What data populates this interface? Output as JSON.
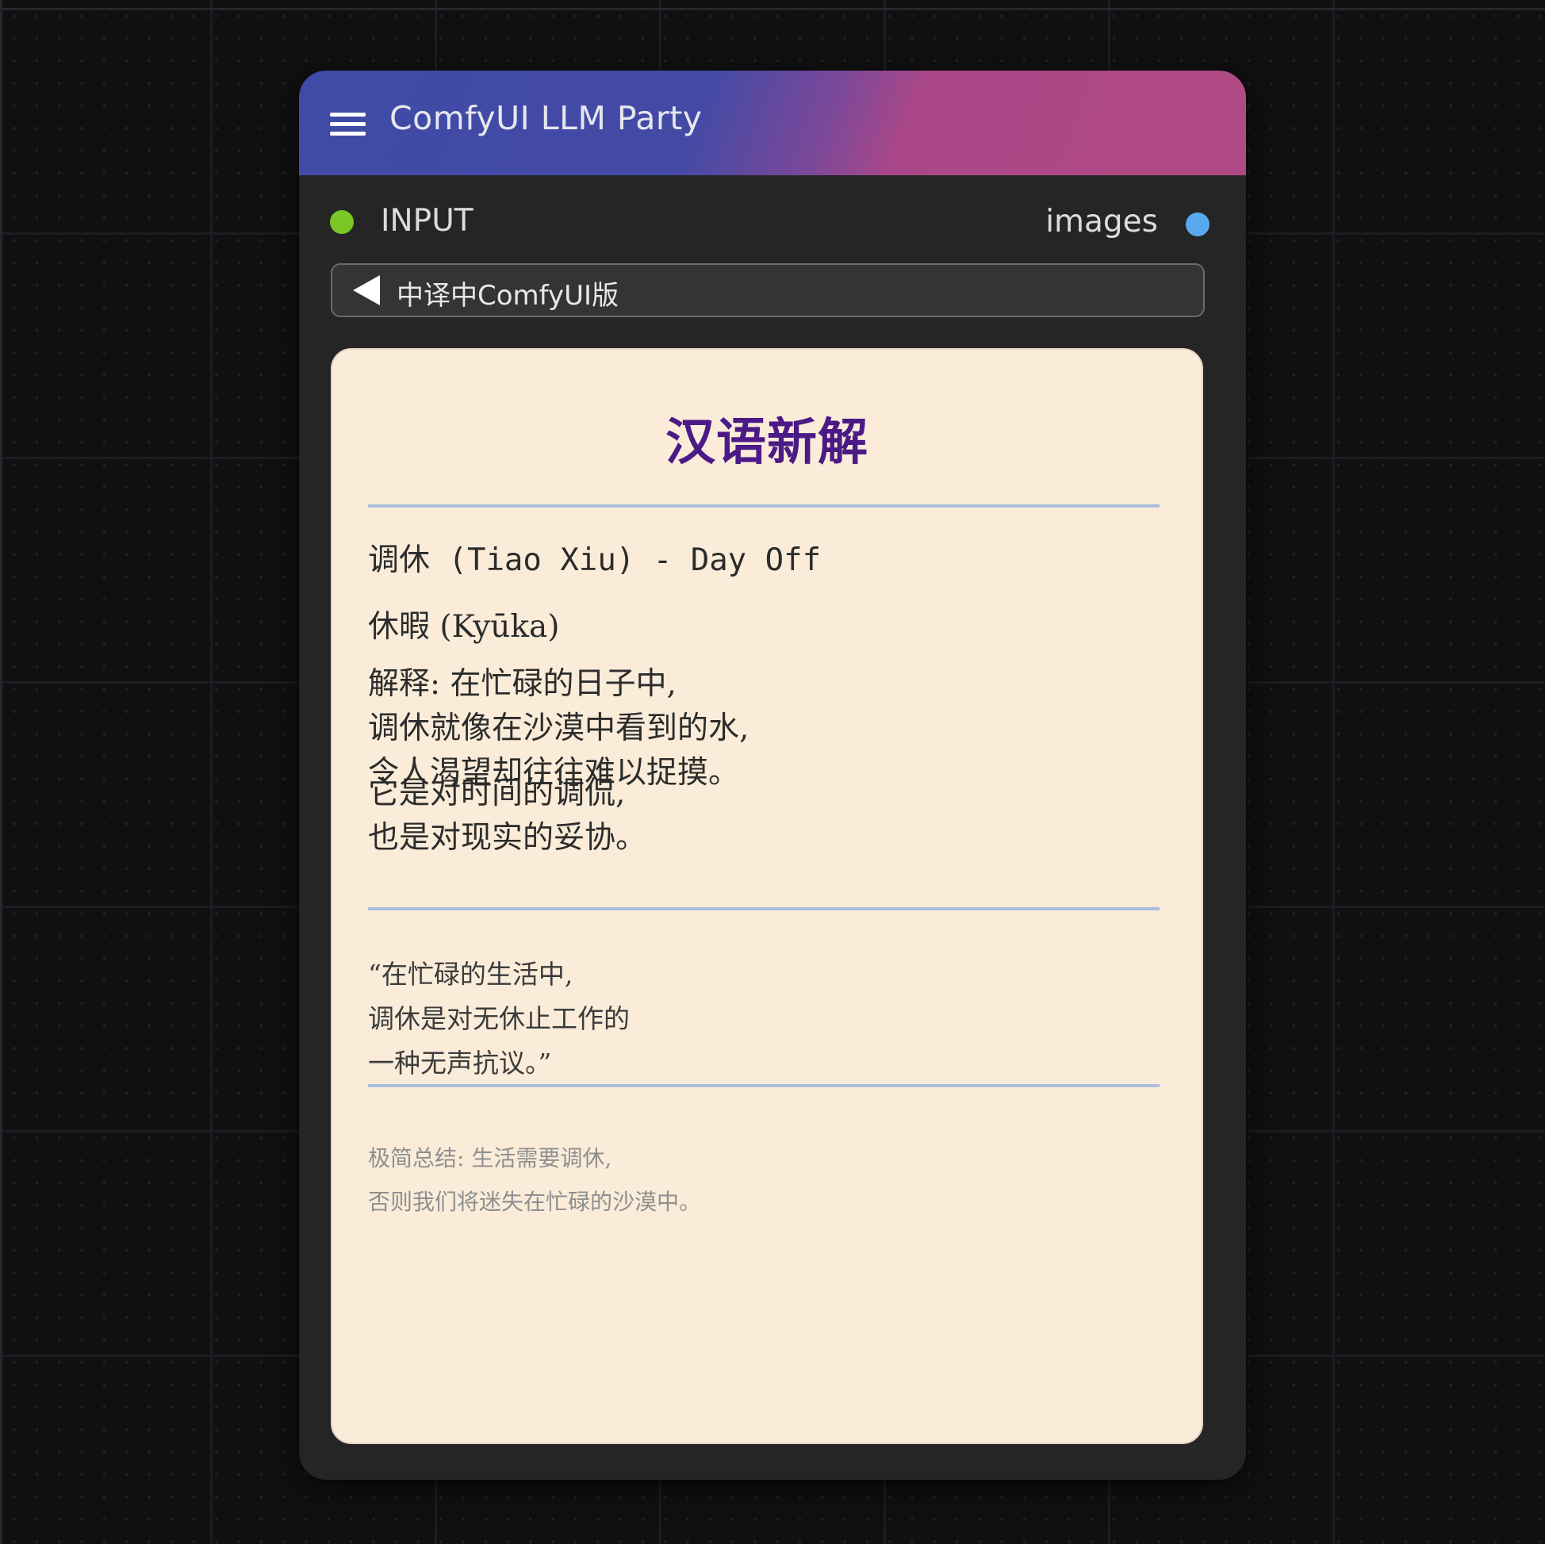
{
  "node": {
    "title": "ComfyUI LLM Party",
    "input_label": "INPUT",
    "output_label": "images",
    "widget_value": "中译中ComfyUI版"
  },
  "card": {
    "title": "汉语新解",
    "heading_main": "调休 (Tiao Xiu) - Day Off",
    "heading_sub": "休暇 (Kyūka)",
    "explanation": [
      "解释: 在忙碌的日子中,",
      "调休就像在沙漠中看到的水,",
      "令人渴望却往往难以捉摸。"
    ],
    "explanation2": [
      "它是对时间的调侃,",
      "也是对现实的妥协。"
    ],
    "quote": [
      "“在忙碌的生活中,",
      "调休是对无休止工作的",
      "一种无声抗议。”"
    ],
    "summary": [
      "极简总结: 生活需要调休,",
      "否则我们将迷失在忙碌的沙漠中。"
    ]
  },
  "colors": {
    "input_dot": "#7ac725",
    "output_dot": "#5aa9ef",
    "card_bg": "#faecd9",
    "title_color": "#4c1a86",
    "divider": "#a9bfe0"
  }
}
